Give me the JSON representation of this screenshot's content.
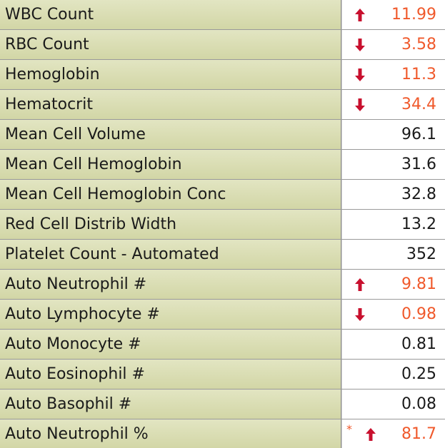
{
  "results": [
    {
      "name": "WBC Count",
      "value": "11.99",
      "flag": "high",
      "flag_icon": "up-arrow-icon",
      "marker": ""
    },
    {
      "name": "RBC Count",
      "value": "3.58",
      "flag": "low",
      "flag_icon": "down-arrow-icon",
      "marker": ""
    },
    {
      "name": "Hemoglobin",
      "value": "11.3",
      "flag": "low",
      "flag_icon": "down-arrow-icon",
      "marker": ""
    },
    {
      "name": "Hematocrit",
      "value": "34.4",
      "flag": "low",
      "flag_icon": "down-arrow-icon",
      "marker": ""
    },
    {
      "name": "Mean Cell Volume",
      "value": "96.1",
      "flag": "normal",
      "flag_icon": "",
      "marker": ""
    },
    {
      "name": "Mean Cell Hemoglobin",
      "value": "31.6",
      "flag": "normal",
      "flag_icon": "",
      "marker": ""
    },
    {
      "name": "Mean Cell Hemoglobin Conc",
      "value": "32.8",
      "flag": "normal",
      "flag_icon": "",
      "marker": ""
    },
    {
      "name": "Red Cell Distrib Width",
      "value": "13.2",
      "flag": "normal",
      "flag_icon": "",
      "marker": ""
    },
    {
      "name": "Platelet Count - Automated",
      "value": "352",
      "flag": "normal",
      "flag_icon": "",
      "marker": ""
    },
    {
      "name": "Auto Neutrophil #",
      "value": "9.81",
      "flag": "high",
      "flag_icon": "up-arrow-icon",
      "marker": ""
    },
    {
      "name": "Auto Lymphocyte #",
      "value": "0.98",
      "flag": "low",
      "flag_icon": "down-arrow-icon",
      "marker": ""
    },
    {
      "name": "Auto Monocyte #",
      "value": "0.81",
      "flag": "normal",
      "flag_icon": "",
      "marker": ""
    },
    {
      "name": "Auto Eosinophil #",
      "value": "0.25",
      "flag": "normal",
      "flag_icon": "",
      "marker": ""
    },
    {
      "name": "Auto Basophil #",
      "value": "0.08",
      "flag": "normal",
      "flag_icon": "",
      "marker": ""
    },
    {
      "name": "Auto Neutrophil %",
      "value": "81.7",
      "flag": "high",
      "flag_icon": "up-arrow-icon",
      "marker": "*"
    }
  ],
  "colors": {
    "abnormal_value": "#f0592b",
    "normal_value": "#1a1a1a",
    "arrow": "#c8102e",
    "name_cell_top": "#e2e5c2",
    "name_cell_bottom": "#d2d6a6"
  }
}
